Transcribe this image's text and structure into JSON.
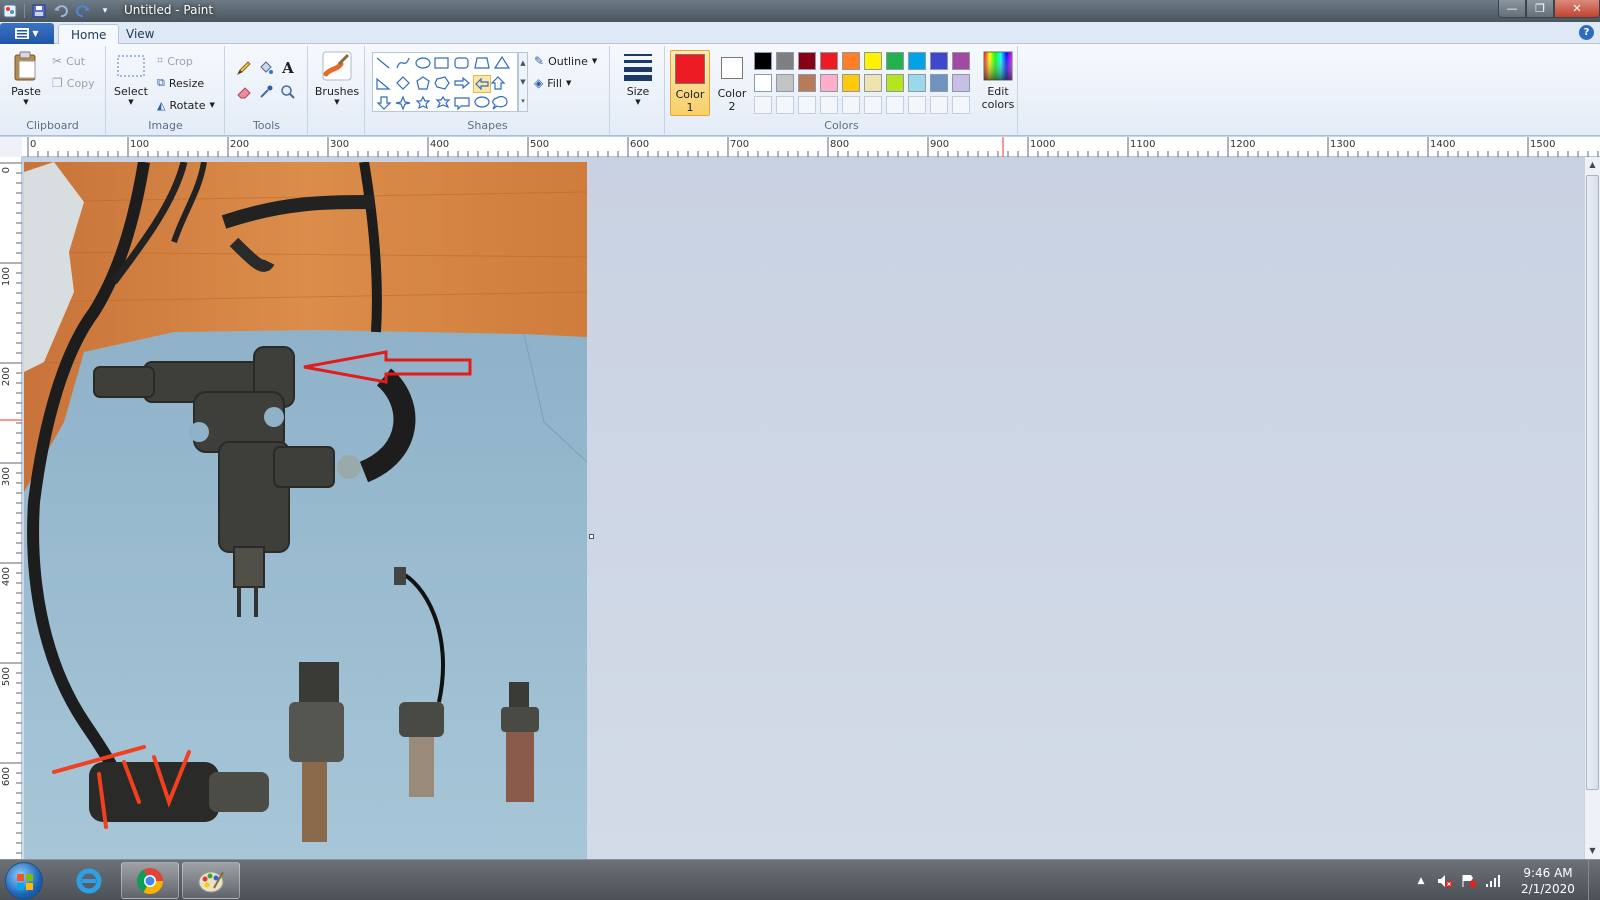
{
  "window": {
    "title": "Untitled - Paint"
  },
  "tabs": [
    {
      "label": "Home",
      "active": true
    },
    {
      "label": "View",
      "active": false
    }
  ],
  "clipboard": {
    "label": "Clipboard",
    "paste": "Paste",
    "cut": "Cut",
    "copy": "Copy"
  },
  "image": {
    "label": "Image",
    "select": "Select",
    "crop": "Crop",
    "resize": "Resize",
    "rotate": "Rotate"
  },
  "tools": {
    "label": "Tools",
    "pencil": "pencil-icon",
    "fill": "fill-bucket-icon",
    "text": "A",
    "eraser": "eraser-icon",
    "picker": "color-picker-icon",
    "magnifier": "magnifier-icon"
  },
  "brushes": {
    "label": "Brushes"
  },
  "shapes": {
    "label": "Shapes",
    "outline": "Outline",
    "fill": "Fill"
  },
  "size": {
    "label": "Size"
  },
  "colors": {
    "label": "Colors",
    "color1": {
      "label_line1": "Color",
      "label_line2": "1",
      "value": "#ed1c24"
    },
    "color2": {
      "label_line1": "Color",
      "label_line2": "2",
      "value": "#ffffff"
    },
    "edit_colors_line1": "Edit",
    "edit_colors_line2": "colors",
    "palette_row1": [
      "#000000",
      "#7f7f7f",
      "#880015",
      "#ed1c24",
      "#ff7f27",
      "#fff200",
      "#22b14c",
      "#00a2e8",
      "#3f48cc",
      "#a349a4"
    ],
    "palette_row2": [
      "#ffffff",
      "#c3c3c3",
      "#b97a57",
      "#ffaec9",
      "#ffc90e",
      "#efe4b0",
      "#b5e61d",
      "#99d9ea",
      "#7092be",
      "#c8bfe7"
    ]
  },
  "ruler": {
    "horizontal": [
      "0",
      "100",
      "200",
      "300",
      "400",
      "500",
      "600",
      "700",
      "800",
      "900",
      "1000",
      "1100",
      "1200",
      "1300",
      "1400",
      "1500"
    ],
    "vertical": [
      "0",
      "100",
      "200",
      "300",
      "400",
      "500",
      "600"
    ]
  },
  "taskbar": {
    "time": "9:46 AM",
    "date": "2/1/2020",
    "apps": [
      "internet-explorer-icon",
      "chrome-icon",
      "paint-icon"
    ]
  }
}
